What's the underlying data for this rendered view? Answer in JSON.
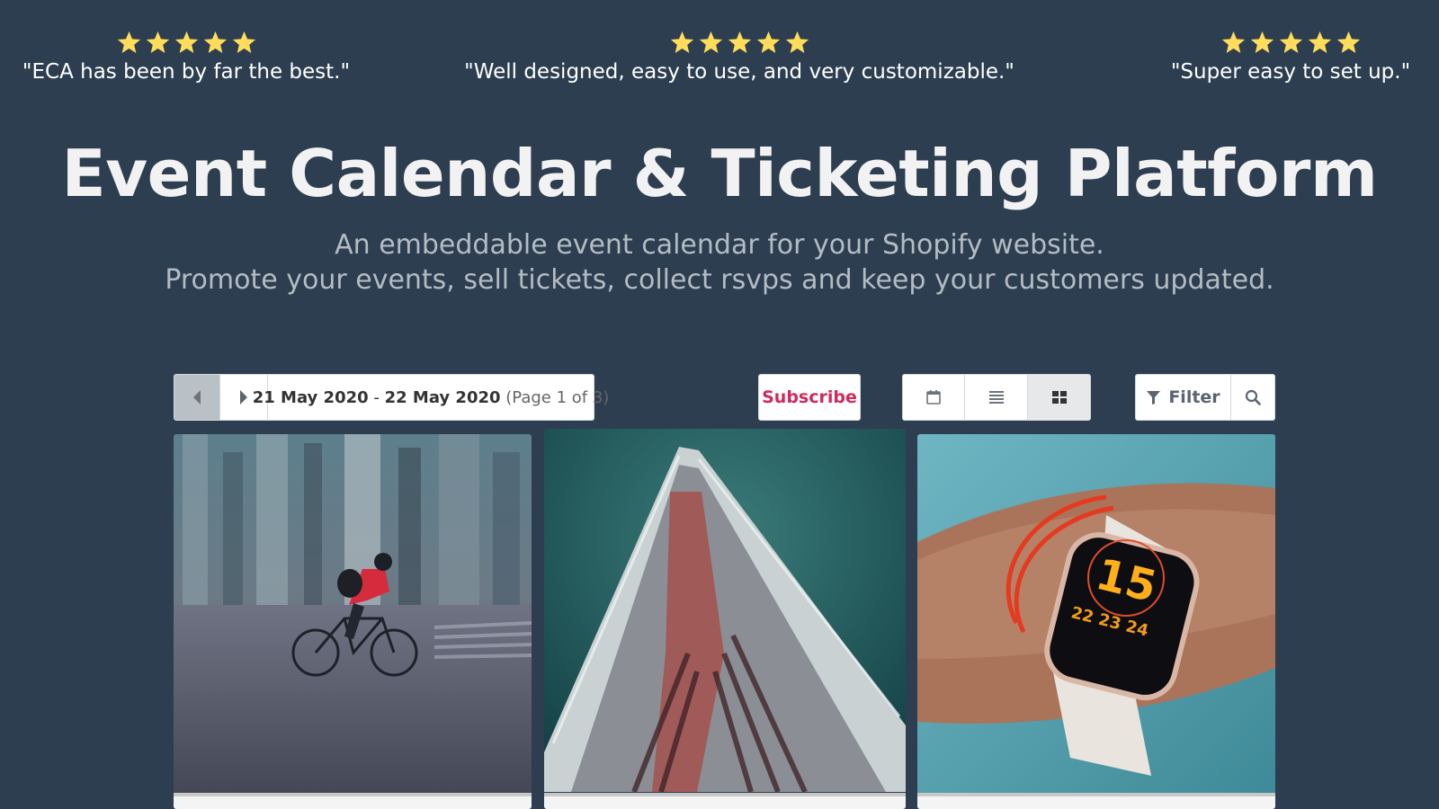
{
  "testimonials": [
    {
      "stars": 5,
      "quote": "\"ECA has been by far the best.\""
    },
    {
      "stars": 5,
      "quote": "\"Well designed, easy to use, and very customizable.\""
    },
    {
      "stars": 5,
      "quote": "\"Super easy to set up.\""
    }
  ],
  "hero": {
    "title": "Event Calendar & Ticketing Platform",
    "subtitle_line1": "An embeddable event calendar for your Shopify website.",
    "subtitle_line2": "Promote your events, sell tickets, collect rsvps and keep your customers updated."
  },
  "toolbar": {
    "date_start": "21 May 2020",
    "date_separator": " - ",
    "date_end": "22 May 2020",
    "page_info": "(Page 1 of 3)",
    "subscribe_label": "Subscribe",
    "filter_label": "Filter",
    "active_view": "grid"
  },
  "events": [
    {
      "image": "cyclist in motion-blurred city street"
    },
    {
      "image": "triangular building facade looking up"
    },
    {
      "image": "smartwatch on wrist with red bracelet"
    }
  ],
  "colors": {
    "background": "#2c3e50",
    "star": "#ffdc5a",
    "subscribe": "#cf2a5b",
    "subtitle": "#b4bcc3"
  }
}
